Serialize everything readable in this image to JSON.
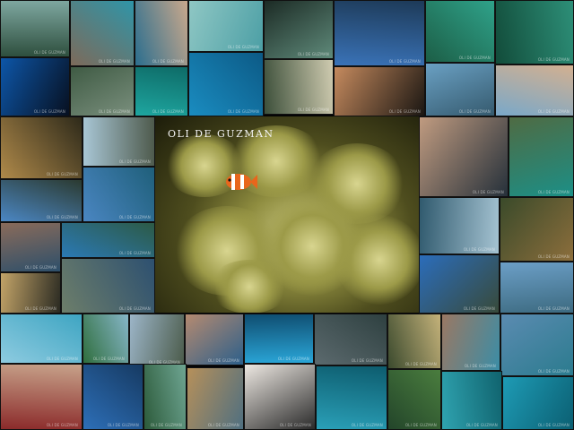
{
  "image_type": "photo collage",
  "watermark": {
    "text": "OLI DE GUZMAN"
  },
  "main_photo": {
    "subject": "clownfish in sea anemone"
  },
  "tiles": [
    {
      "name": "cliffs-lagoon",
      "colors": [
        "#2e4f3e",
        "#7ea7a0"
      ]
    },
    {
      "name": "couple-swimming",
      "colors": [
        "#7d6a5a",
        "#2f95a8"
      ]
    },
    {
      "name": "girl-sunglasses",
      "colors": [
        "#2b6e8e",
        "#c9a88c"
      ]
    },
    {
      "name": "people-wading",
      "colors": [
        "#8fc7c4",
        "#4c9fa5"
      ]
    },
    {
      "name": "dark-cave-lagoon",
      "colors": [
        "#1c2b25",
        "#5f8a7a"
      ]
    },
    {
      "name": "islands-sky",
      "colors": [
        "#3a73b8",
        "#1d3a58"
      ]
    },
    {
      "name": "reef-green",
      "colors": [
        "#1c5e46",
        "#2fa28a"
      ]
    },
    {
      "name": "coral-teal",
      "colors": [
        "#124c3a",
        "#2d8f78"
      ]
    },
    {
      "name": "cross-silhouette",
      "colors": [
        "#0d56a8",
        "#071020"
      ]
    },
    {
      "name": "tree-over-water",
      "colors": [
        "#3f5b44",
        "#7a8f7d"
      ]
    },
    {
      "name": "turquoise-shallows",
      "colors": [
        "#1ea6a0",
        "#0e6b67"
      ]
    },
    {
      "name": "underwater-blue",
      "colors": [
        "#1a8cc0",
        "#0c5a86"
      ]
    },
    {
      "name": "person-on-beach",
      "colors": [
        "#3c4f3a",
        "#cfcbb0"
      ]
    },
    {
      "name": "sunset-islands",
      "colors": [
        "#c58a5e",
        "#1a1612"
      ]
    },
    {
      "name": "karst-bay",
      "colors": [
        "#6aa0c3",
        "#355a6e"
      ]
    },
    {
      "name": "woman-sunglasses-sky",
      "colors": [
        "#79a8c9",
        "#d3b090"
      ]
    },
    {
      "name": "golden-cliff-sunset",
      "colors": [
        "#b08a4a",
        "#2e2a1a"
      ]
    },
    {
      "name": "rock-island",
      "colors": [
        "#a9c7d6",
        "#4e5a4c"
      ]
    },
    {
      "name": "man-closeup",
      "colors": [
        "#c09b80",
        "#25303a"
      ]
    },
    {
      "name": "mossy-cliff",
      "colors": [
        "#4f6b43",
        "#1c8f86"
      ]
    },
    {
      "name": "blue-sky-cliff",
      "colors": [
        "#4b87c4",
        "#2b3a30"
      ]
    },
    {
      "name": "kayak-island",
      "colors": [
        "#4a86c2",
        "#1f5f7a"
      ]
    },
    {
      "name": "rock-formation",
      "colors": [
        "#305a6e",
        "#a5c3d2"
      ]
    },
    {
      "name": "coral-reef-small",
      "colors": [
        "#3a4a2a",
        "#8c6e3c"
      ]
    },
    {
      "name": "couple-selfie",
      "colors": [
        "#8a6b5a",
        "#2d4f6a"
      ]
    },
    {
      "name": "lagoon-mountains",
      "colors": [
        "#2b79b5",
        "#2c5a46"
      ]
    },
    {
      "name": "rocky-shore",
      "colors": [
        "#6d7e6a",
        "#2d5070"
      ]
    },
    {
      "name": "mountain-dusk",
      "colors": [
        "#c3a468",
        "#2a2a22"
      ]
    },
    {
      "name": "cliff-sky",
      "colors": [
        "#2b6dbb",
        "#384a3a"
      ]
    },
    {
      "name": "boat-bay",
      "colors": [
        "#6c9fc7",
        "#3c6a80"
      ]
    },
    {
      "name": "snorkel-jump",
      "colors": [
        "#8ecbe0",
        "#3ea5c2"
      ]
    },
    {
      "name": "lagoon-walk",
      "colors": [
        "#2f6e3d",
        "#86b6c8"
      ]
    },
    {
      "name": "rock-tower",
      "colors": [
        "#9cb5c8",
        "#4b5b4a"
      ]
    },
    {
      "name": "screaming-friends",
      "colors": [
        "#b58a70",
        "#2c5f8a"
      ]
    },
    {
      "name": "starfish-hand",
      "colors": [
        "#0f4d70",
        "#2aa6d8"
      ]
    },
    {
      "name": "rocky-reef-gray",
      "colors": [
        "#5c6a6e",
        "#2e4040"
      ]
    },
    {
      "name": "palm-beach-hut",
      "colors": [
        "#3b4a2e",
        "#c4b27a"
      ]
    },
    {
      "name": "couple-in-water",
      "colors": [
        "#9a7863",
        "#3b8da6"
      ]
    },
    {
      "name": "boats-lagoon",
      "colors": [
        "#5b8bb1",
        "#2b7b8e"
      ]
    },
    {
      "name": "friends-selfie-red",
      "colors": [
        "#8b2a2a",
        "#c7a28a"
      ]
    },
    {
      "name": "clouds-island",
      "colors": [
        "#2d6fb8",
        "#163a62"
      ]
    },
    {
      "name": "green-bay",
      "colors": [
        "#2c5a3a",
        "#6ea592"
      ]
    },
    {
      "name": "beach-person",
      "colors": [
        "#b6905a",
        "#4f6f80"
      ]
    },
    {
      "name": "duo-sunglasses",
      "colors": [
        "#ede8e2",
        "#2a2a2a"
      ]
    },
    {
      "name": "diver-underwater",
      "colors": [
        "#2aa0b8",
        "#0d5c6e"
      ]
    },
    {
      "name": "sea-plants",
      "colors": [
        "#23452a",
        "#4a7d3e"
      ]
    },
    {
      "name": "snorkel-dive",
      "colors": [
        "#2fa3b0",
        "#10636e"
      ]
    },
    {
      "name": "teal-water",
      "colors": [
        "#1e9bb5",
        "#0b5f72"
      ]
    },
    {
      "name": "island-horizon",
      "colors": [
        "#2e7dbd",
        "#2c5d4a"
      ]
    }
  ]
}
